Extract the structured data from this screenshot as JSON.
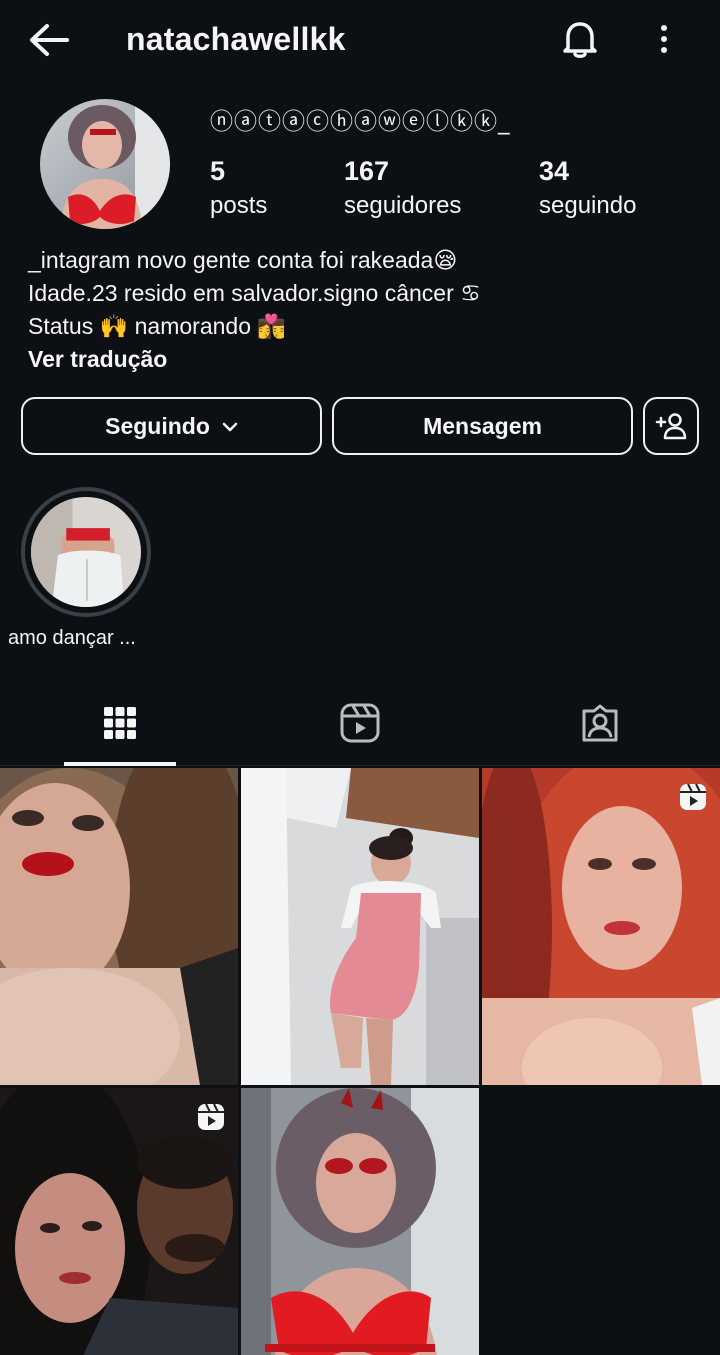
{
  "header": {
    "username": "natachawellkk",
    "back_icon": "arrow-left-icon",
    "bell_icon": "bell-icon",
    "more_icon": "more-vertical-icon"
  },
  "profile": {
    "display_name": "ⓝⓐⓣⓐⓒⓗⓐⓦⓔⓛⓚⓚ_",
    "stats": {
      "posts": {
        "value": "5",
        "label": "posts"
      },
      "followers": {
        "value": "167",
        "label": "seguidores"
      },
      "following": {
        "value": "34",
        "label": "seguindo"
      }
    },
    "bio_lines": [
      "_intagram novo gente conta foi rakeada😪",
      "Idade.23 resido em salvador.signo câncer ♋",
      "Status 🙌 namorando 👩‍❤️‍💋‍👨"
    ],
    "translate_label": "Ver tradução"
  },
  "actions": {
    "following_label": "Seguindo",
    "message_label": "Mensagem",
    "add_user_icon": "add-user-icon"
  },
  "highlights": [
    {
      "label": "amo dançar ..."
    }
  ],
  "tabs": [
    {
      "icon": "grid-icon",
      "active": true
    },
    {
      "icon": "reels-icon",
      "active": false
    },
    {
      "icon": "tagged-icon",
      "active": false
    }
  ],
  "posts": [
    {
      "type": "photo"
    },
    {
      "type": "photo"
    },
    {
      "type": "reel"
    },
    {
      "type": "reel"
    },
    {
      "type": "photo"
    }
  ],
  "colors": {
    "background": "#0c1014",
    "text": "#f5f5f5",
    "border": "#f0f0f0"
  }
}
